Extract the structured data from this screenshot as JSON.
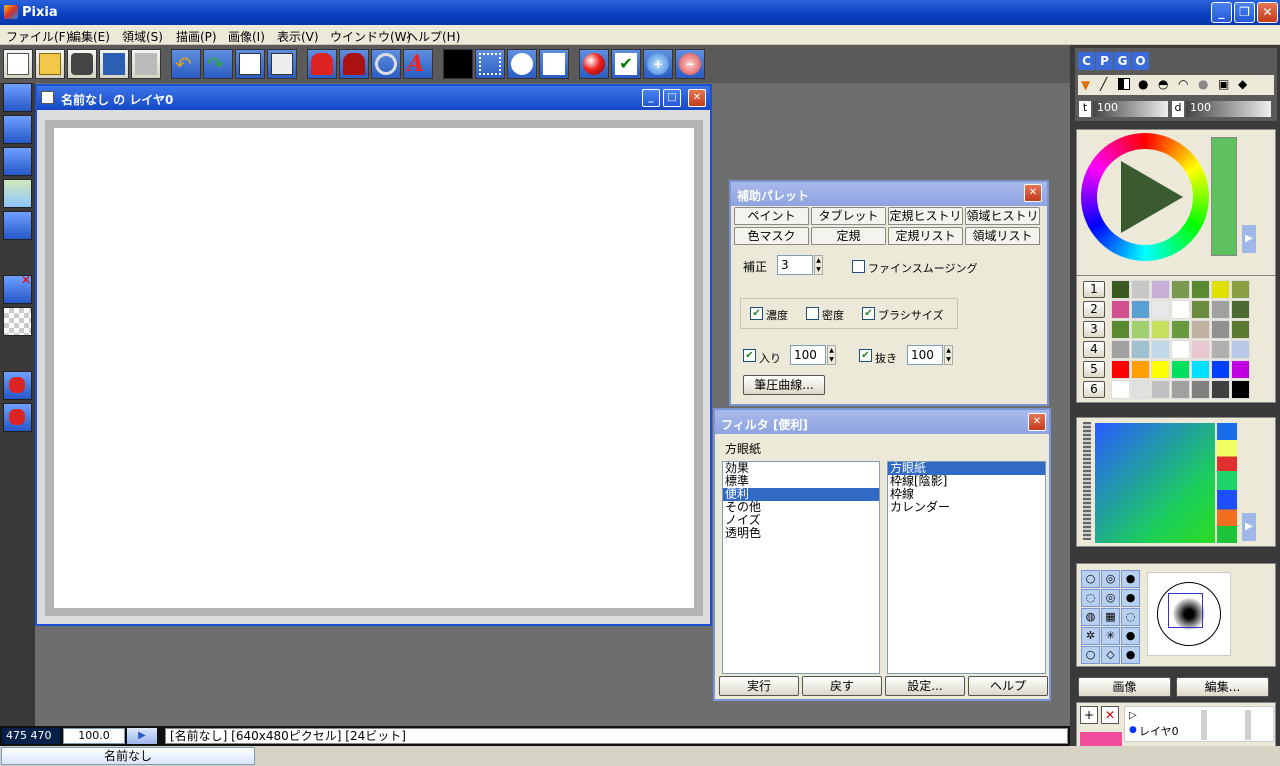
{
  "window": {
    "title": "Pixia"
  },
  "menu": [
    "ファイル(F)",
    "編集(E)",
    "領域(S)",
    "描画(P)",
    "画像(I)",
    "表示(V)",
    "ウインドウ(W)",
    "ヘルプ(H)"
  ],
  "document": {
    "title": "名前なし の レイヤ0"
  },
  "assist_palette": {
    "title": "補助パレット",
    "tabs_row1": [
      "ペイント",
      "タブレット",
      "定規ヒストリ",
      "領域ヒストリ"
    ],
    "tabs_row2": [
      "色マスク",
      "定規",
      "定規リスト",
      "領域リスト"
    ],
    "correction_label": "補正",
    "correction_value": "3",
    "fine_smoothing": "ファインスムージング",
    "density": "濃度",
    "opacity": "密度",
    "brush_size": "ブラシサイズ",
    "in_label": "入り",
    "in_value": "100",
    "out_label": "抜き",
    "out_value": "100",
    "pressure_curve": "筆圧曲線..."
  },
  "filter": {
    "title": "フィルタ [便利]",
    "current": "方眼紙",
    "categories": [
      "効果",
      "標準",
      "便利",
      "その他",
      "ノイズ",
      "透明色"
    ],
    "selected_category": "便利",
    "items": [
      "方眼紙",
      "枠線[陰影]",
      "枠線",
      "カレンダー"
    ],
    "selected_item": "方眼紙",
    "buttons": {
      "run": "実行",
      "back": "戻す",
      "settings": "設定...",
      "help": "ヘルプ"
    }
  },
  "right_panel": {
    "mode_tabs": [
      "C",
      "P",
      "G",
      "O"
    ],
    "t_label": "t",
    "t_value": "100",
    "d_label": "d",
    "d_value": "100",
    "palette_rows": [
      "1",
      "2",
      "3",
      "4",
      "5",
      "6"
    ],
    "image_button": "画像",
    "edit_button": "編集...",
    "layer_name": "レイヤ0"
  },
  "status": {
    "coords": "475 470",
    "zoom": "100.0",
    "info": "[名前なし] [640x480ピクセル] [24ビット]"
  },
  "taskbar": {
    "doc": "名前なし"
  },
  "colors": {
    "title_blue": "#0a3fc0",
    "selection": "#316ac5",
    "foreground_pink": "#f04c9c"
  }
}
